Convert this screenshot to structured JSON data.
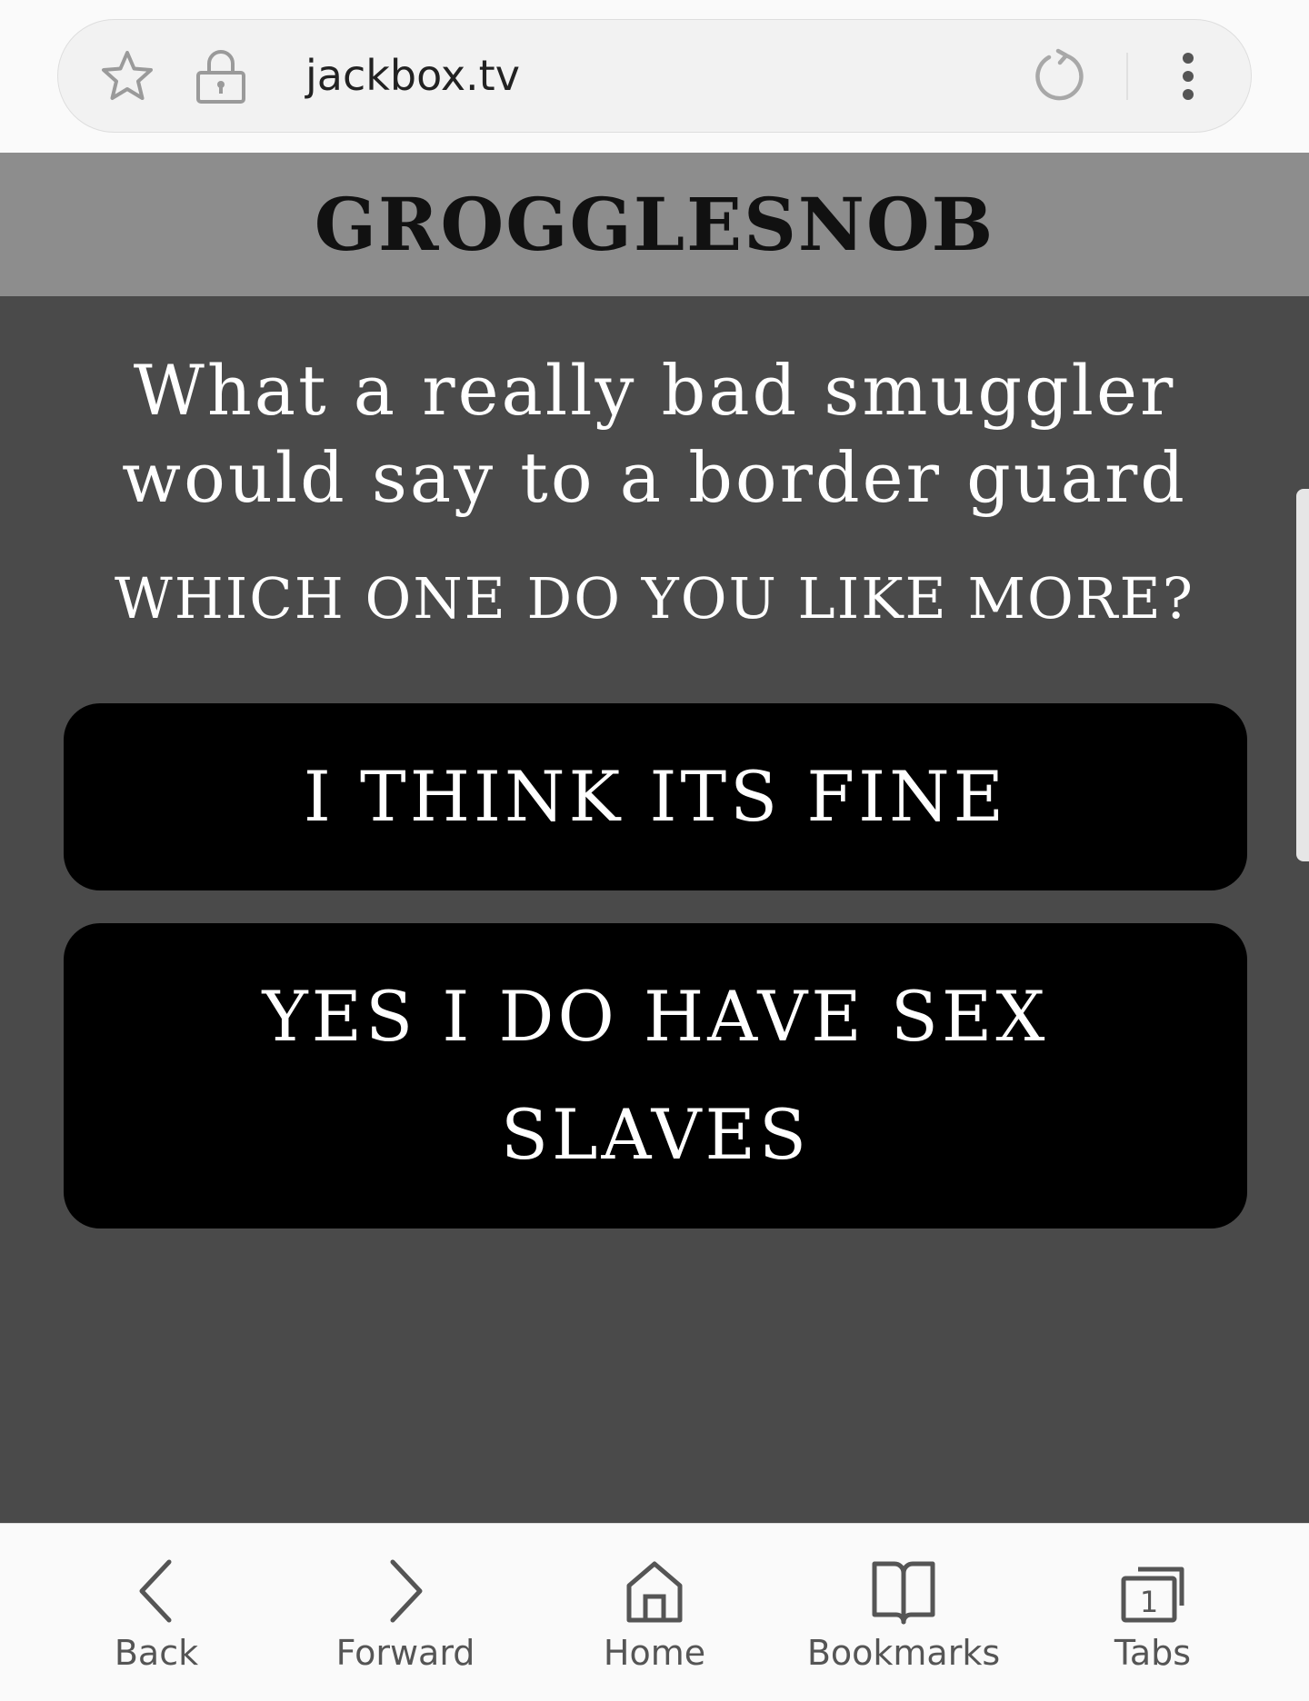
{
  "browser": {
    "url": "jackbox.tv",
    "icons": {
      "bookmark": "star-icon",
      "security": "lock-icon",
      "reload": "reload-icon",
      "menu": "more-vertical-icon"
    }
  },
  "game": {
    "player_name": "GROGGLESNOB",
    "prompt": "What a really bad smuggler would say to a border guard",
    "instruction": "WHICH ONE DO YOU LIKE MORE?",
    "choices": [
      {
        "label": "I THINK ITS FINE"
      },
      {
        "label": "YES I DO HAVE SEX SLAVES"
      }
    ]
  },
  "bottom_nav": {
    "items": [
      {
        "label": "Back",
        "icon": "chevron-left-icon"
      },
      {
        "label": "Forward",
        "icon": "chevron-right-icon"
      },
      {
        "label": "Home",
        "icon": "home-icon"
      },
      {
        "label": "Bookmarks",
        "icon": "book-icon"
      },
      {
        "label": "Tabs",
        "icon": "tabs-icon",
        "count": "1"
      }
    ]
  },
  "colors": {
    "header_bg": "#8d8d8d",
    "content_bg": "#4a4a4a",
    "choice_bg": "#000000",
    "text_light": "#ffffff",
    "chrome_bg": "#fafafa"
  }
}
